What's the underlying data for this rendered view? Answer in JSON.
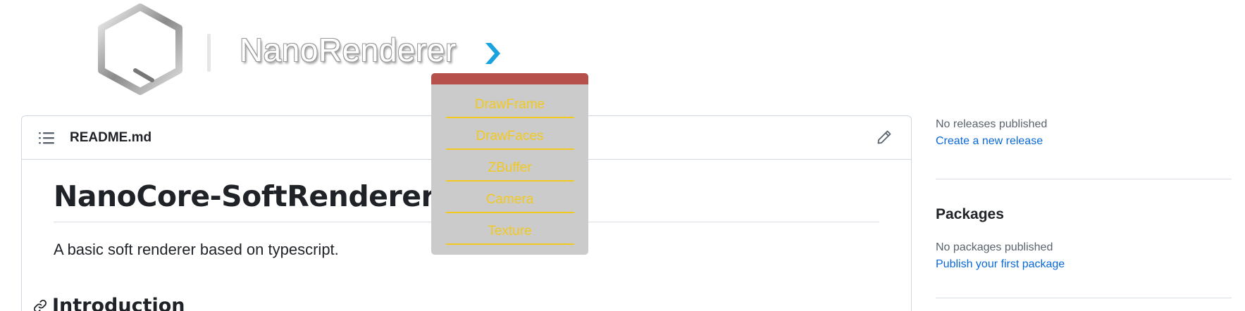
{
  "banner": {
    "title": "NanoRenderer",
    "arrow_color": "#1aa3dd",
    "logo_icon": "hexagon-logo-icon"
  },
  "readme": {
    "filename": "README.md",
    "toc_icon": "list-icon",
    "edit_icon": "pencil-icon",
    "title": "NanoCore-SoftRenderer",
    "description": "A basic soft renderer based on typescript.",
    "section_heading": "Introduction",
    "section_icon": "link-icon"
  },
  "sidebar": {
    "releases_status": "No releases published",
    "releases_link": "Create a new release",
    "packages_title": "Packages",
    "packages_status": "No packages published",
    "packages_link": "Publish your first package"
  },
  "dropdown": {
    "header_color": "#b5504a",
    "item_color": "#f2c91f",
    "items": [
      {
        "label": "DrawFrame"
      },
      {
        "label": "DrawFaces"
      },
      {
        "label": "ZBuffer"
      },
      {
        "label": "Camera"
      },
      {
        "label": "Texture"
      }
    ]
  }
}
